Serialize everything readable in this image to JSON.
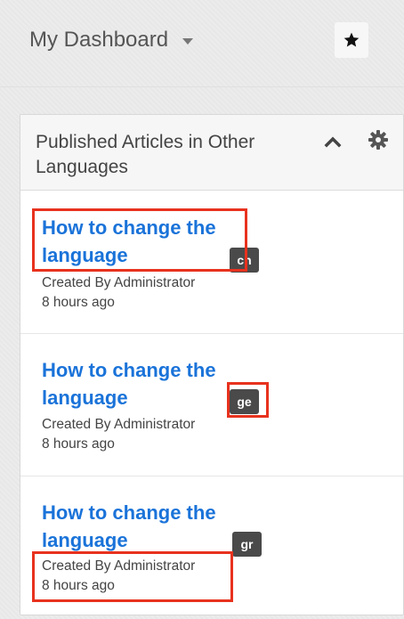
{
  "header": {
    "title": "My Dashboard",
    "caret_icon": "caret-down-icon",
    "star_icon": "star-icon"
  },
  "dashlet": {
    "title": "Published Articles in Other Languages",
    "collapse_icon": "chevron-up-icon",
    "settings_icon": "gear-icon",
    "articles": [
      {
        "title": "How to change the language",
        "lang": "ch",
        "created_by": "Created By Administrator",
        "time": "8 hours ago"
      },
      {
        "title": "How to change the language",
        "lang": "ge",
        "created_by": "Created By Administrator",
        "time": "8 hours ago"
      },
      {
        "title": "How to change the language",
        "lang": "gr",
        "created_by": "Created By Administrator",
        "time": "8 hours ago"
      }
    ]
  },
  "colors": {
    "link": "#1a73d9",
    "badge_bg": "#4a4a4a",
    "highlight": "#e8321e"
  }
}
